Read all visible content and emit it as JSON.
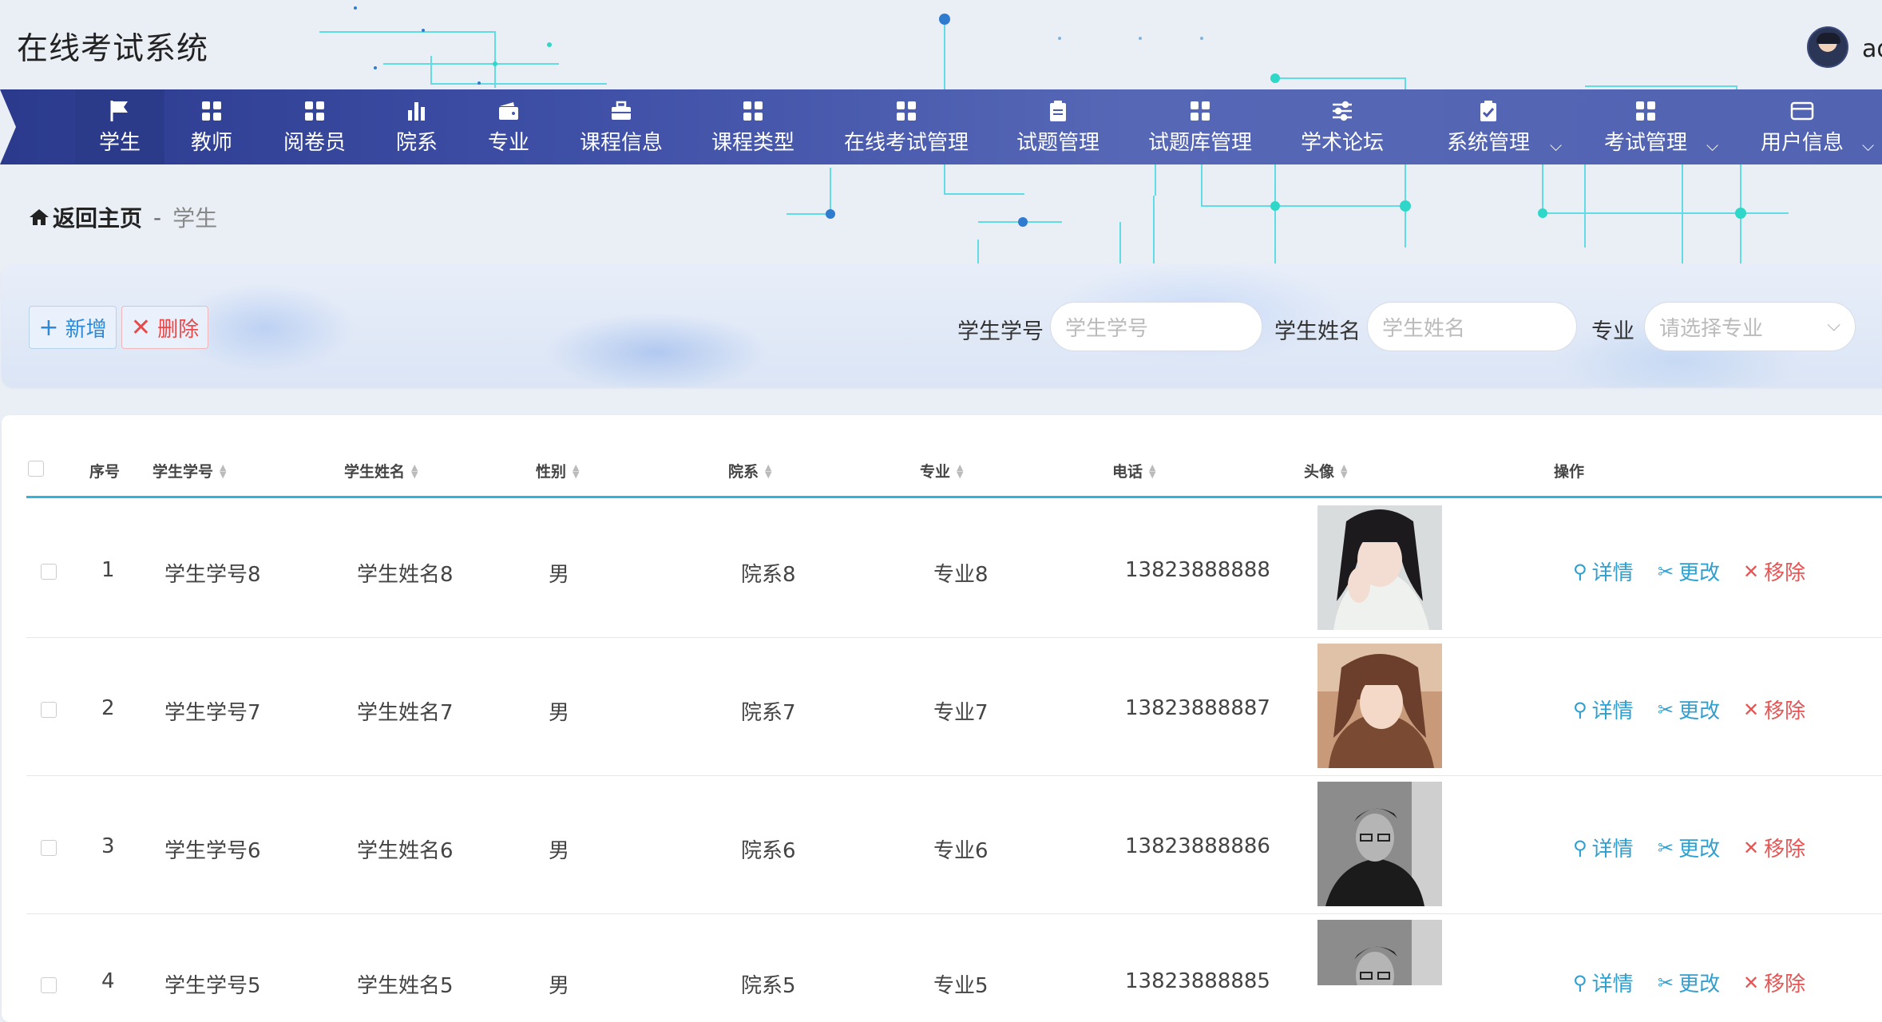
{
  "header": {
    "title": "在线考试系统",
    "username": "ad"
  },
  "nav": [
    {
      "label": "学生",
      "icon": "flag-icon",
      "active": true
    },
    {
      "label": "教师",
      "icon": "grid-icon"
    },
    {
      "label": "阅卷员",
      "icon": "grid-icon"
    },
    {
      "label": "院系",
      "icon": "bar-chart-icon"
    },
    {
      "label": "专业",
      "icon": "wallet-icon"
    },
    {
      "label": "课程信息",
      "icon": "briefcase-icon"
    },
    {
      "label": "课程类型",
      "icon": "grid-icon"
    },
    {
      "label": "在线考试管理",
      "icon": "grid-icon"
    },
    {
      "label": "试题管理",
      "icon": "clipboard-icon"
    },
    {
      "label": "试题库管理",
      "icon": "grid-icon"
    },
    {
      "label": "学术论坛",
      "icon": "sliders-icon"
    },
    {
      "label": "系统管理",
      "icon": "clipboard-check-icon",
      "dropdown": true
    },
    {
      "label": "考试管理",
      "icon": "grid-icon",
      "dropdown": true
    },
    {
      "label": "用户信息",
      "icon": "card-icon",
      "dropdown": true
    }
  ],
  "breadcrumb": {
    "home": "返回主页",
    "separator": "-",
    "current": "学生"
  },
  "toolbar": {
    "add": "新增",
    "delete": "删除"
  },
  "filters": {
    "student_no_label": "学生学号",
    "student_no_placeholder": "学生学号",
    "student_name_label": "学生姓名",
    "student_name_placeholder": "学生姓名",
    "major_label": "专业",
    "major_placeholder": "请选择专业"
  },
  "table": {
    "columns": [
      "序号",
      "学生学号",
      "学生姓名",
      "性别",
      "院系",
      "专业",
      "电话",
      "头像",
      "操作"
    ],
    "rows": [
      {
        "index": "1",
        "student_no": "学生学号8",
        "name": "学生姓名8",
        "gender": "男",
        "dept": "院系8",
        "major": "专业8",
        "phone": "13823888888",
        "avatar": "portrait-photo-woman-1"
      },
      {
        "index": "2",
        "student_no": "学生学号7",
        "name": "学生姓名7",
        "gender": "男",
        "dept": "院系7",
        "major": "专业7",
        "phone": "13823888887",
        "avatar": "portrait-photo-woman-2"
      },
      {
        "index": "3",
        "student_no": "学生学号6",
        "name": "学生姓名6",
        "gender": "男",
        "dept": "院系6",
        "major": "专业6",
        "phone": "13823888886",
        "avatar": "portrait-photo-man-1"
      },
      {
        "index": "4",
        "student_no": "学生学号5",
        "name": "学生姓名5",
        "gender": "男",
        "dept": "院系5",
        "major": "专业5",
        "phone": "13823888885",
        "avatar": "portrait-photo-man-2"
      }
    ],
    "actions": {
      "detail": "详情",
      "edit": "更改",
      "remove": "移除"
    }
  },
  "colors": {
    "nav_start": "#2b3a8c",
    "nav_end": "#5263b2",
    "accent": "#30b4dc",
    "danger": "#e75454"
  }
}
